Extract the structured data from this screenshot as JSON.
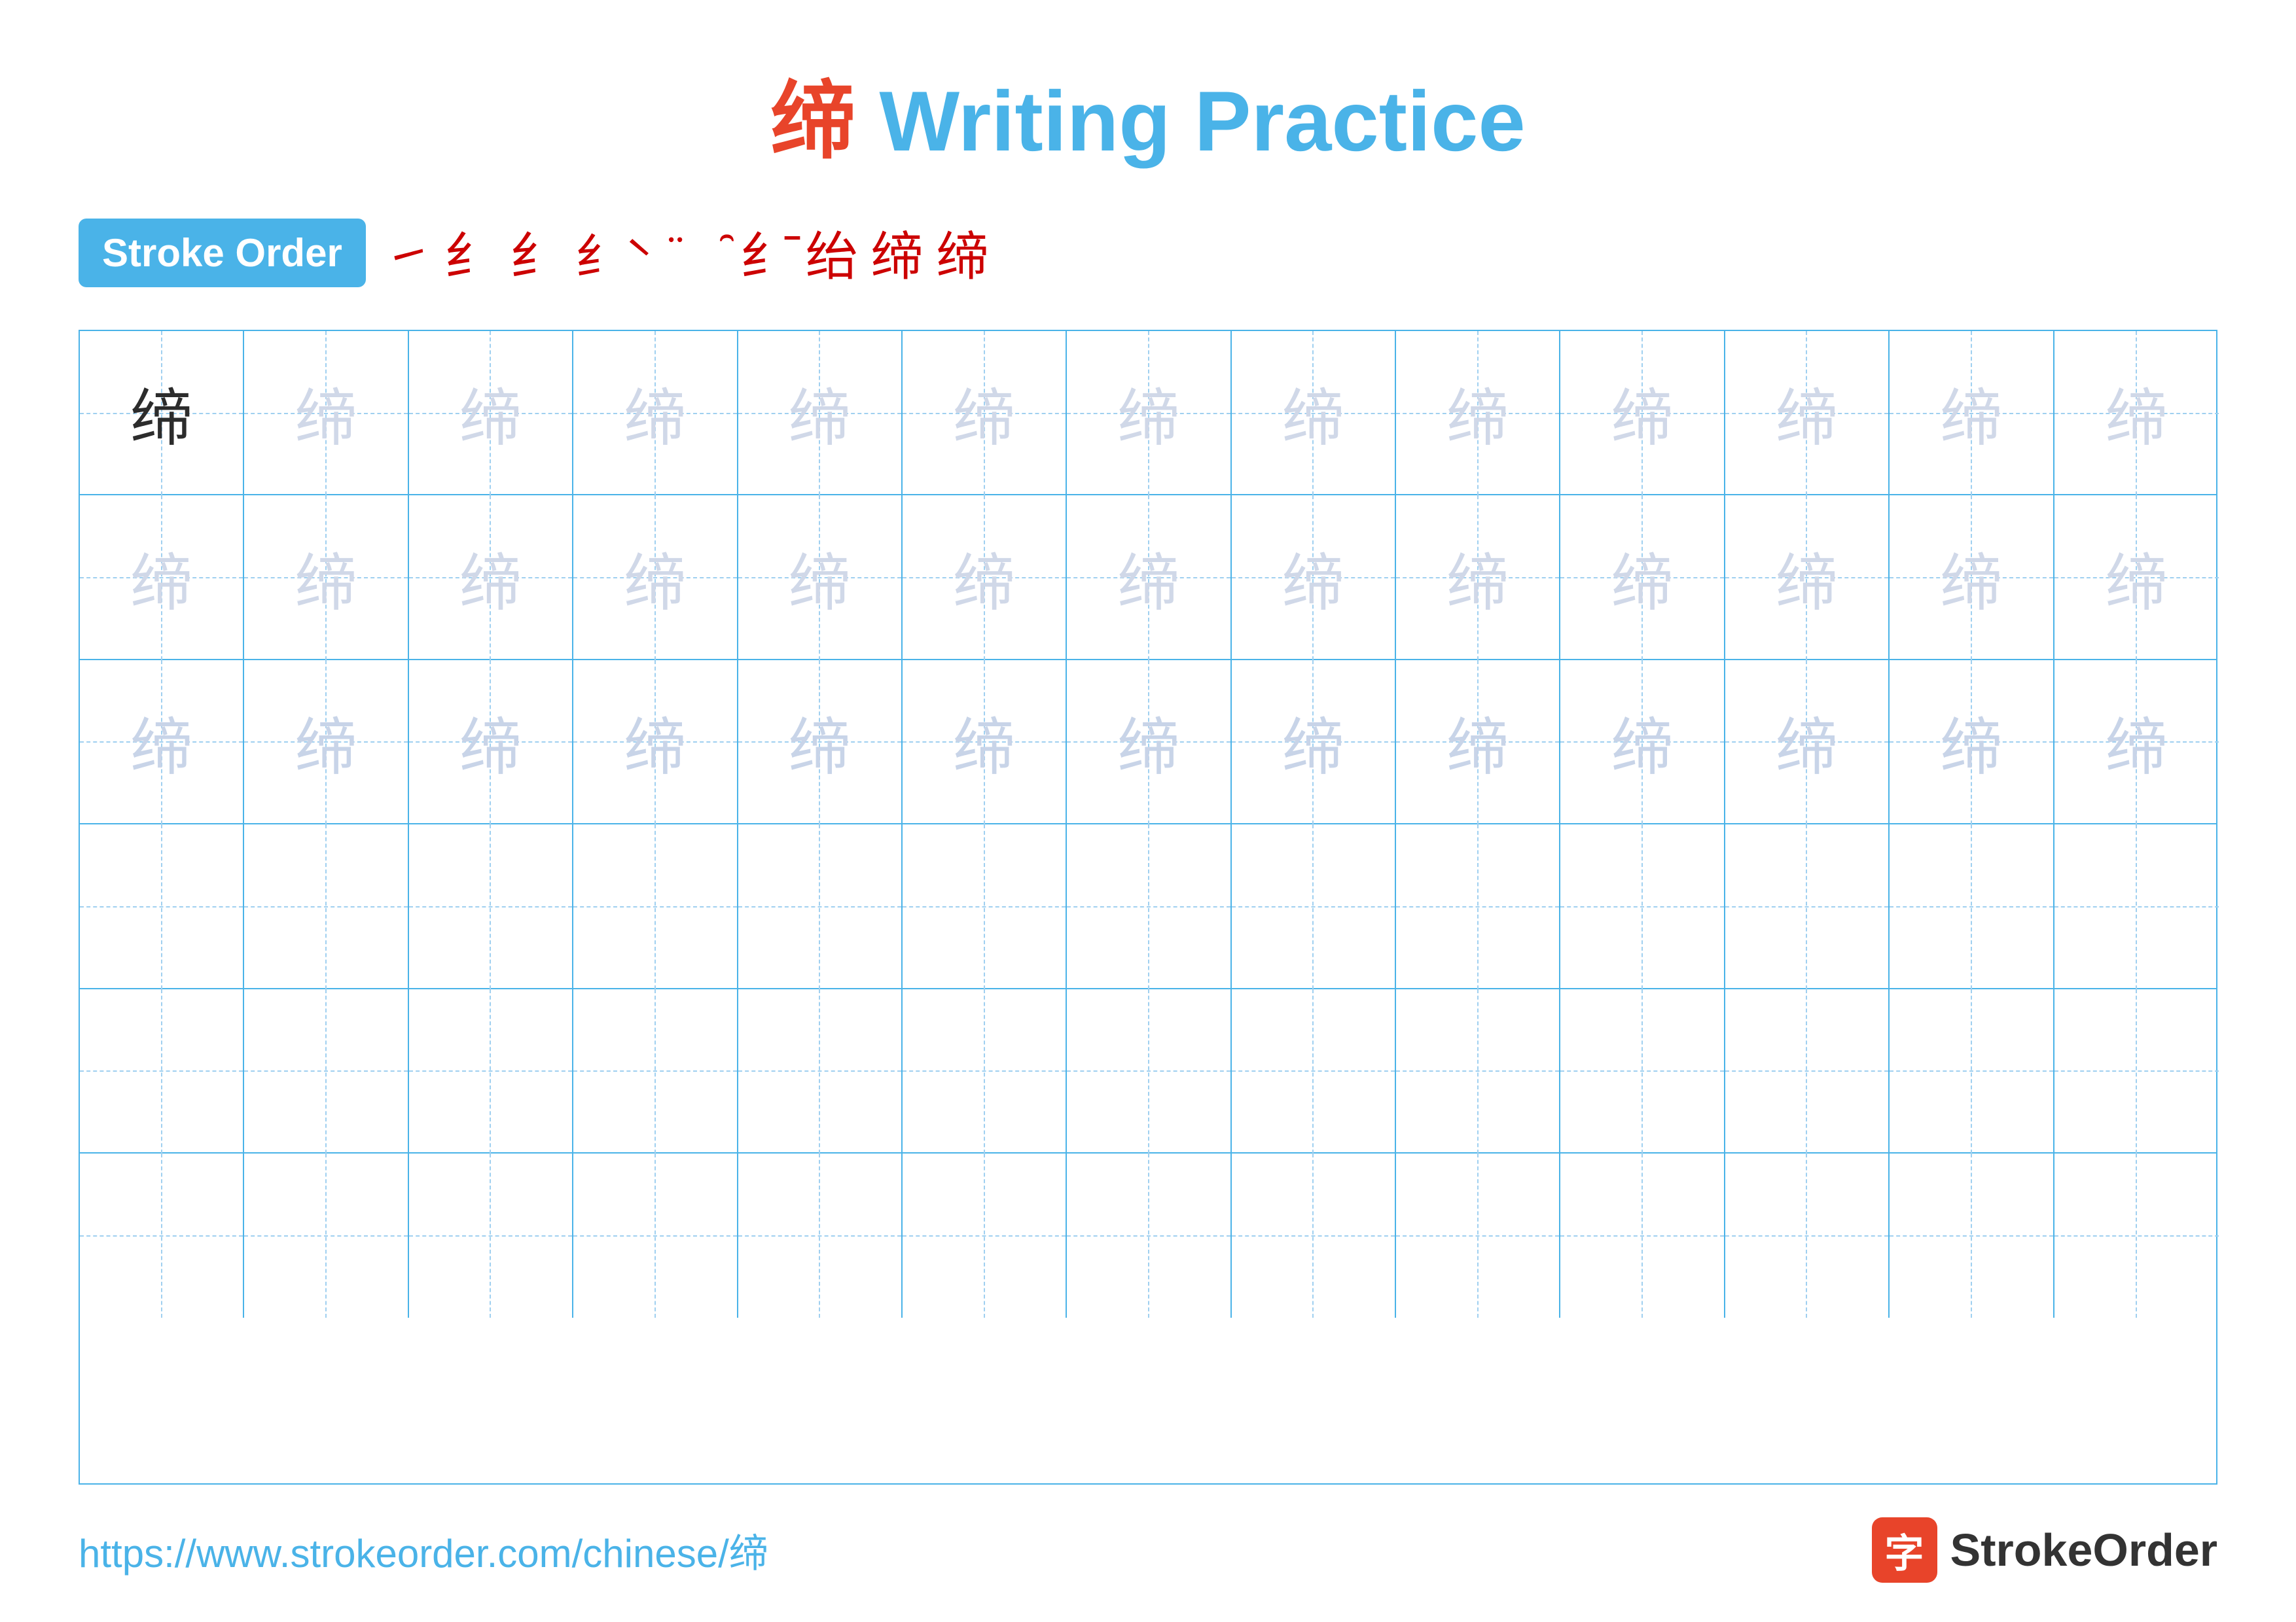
{
  "title": {
    "char": "缔",
    "suffix": " Writing Practice",
    "full": "缔 Writing Practice"
  },
  "stroke_order": {
    "badge_label": "Stroke Order",
    "strokes": [
      "㇀",
      "纟",
      "纟",
      "纟̀",
      "纟̈",
      "纟̈",
      "纟̄",
      "绐",
      "缔",
      "缔"
    ]
  },
  "grid": {
    "rows": 6,
    "cols": 13,
    "character": "缔",
    "row_styles": [
      "dark_first",
      "light",
      "light",
      "empty",
      "empty",
      "empty"
    ]
  },
  "footer": {
    "url": "https://www.strokeorder.com/chinese/缔",
    "logo_text": "StrokeOrder",
    "logo_icon": "字"
  }
}
